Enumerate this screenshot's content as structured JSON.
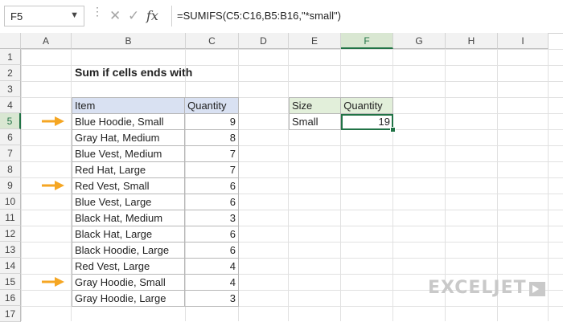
{
  "toolbar": {
    "name_box": "F5",
    "cancel_icon": "✕",
    "confirm_icon": "✓",
    "fx_label": "fx",
    "formula": "=SUMIFS(C5:C16,B5:B16,\"*small\")"
  },
  "columns": [
    "A",
    "B",
    "C",
    "D",
    "E",
    "F",
    "G",
    "H",
    "I"
  ],
  "rows": [
    "1",
    "2",
    "3",
    "4",
    "5",
    "6",
    "7",
    "8",
    "9",
    "10",
    "11",
    "12",
    "13",
    "14",
    "15",
    "16",
    "17"
  ],
  "selected_column": "F",
  "selected_row": "5",
  "sheet": {
    "title": "Sum if cells ends with",
    "table": {
      "headers": [
        "Item",
        "Quantity"
      ],
      "rows": [
        [
          "Blue Hoodie, Small",
          "9"
        ],
        [
          "Gray Hat, Medium",
          "8"
        ],
        [
          "Blue Vest, Medium",
          "7"
        ],
        [
          "Red Hat, Large",
          "7"
        ],
        [
          "Red Vest, Small",
          "6"
        ],
        [
          "Blue Vest, Large",
          "6"
        ],
        [
          "Black Hat, Medium",
          "3"
        ],
        [
          "Black Hat, Large",
          "6"
        ],
        [
          "Black Hoodie, Large",
          "6"
        ],
        [
          "Red Vest, Large",
          "4"
        ],
        [
          "Gray Hoodie, Small",
          "4"
        ],
        [
          "Gray Hoodie, Large",
          "3"
        ]
      ]
    },
    "summary": {
      "headers": [
        "Size",
        "Quantity"
      ],
      "size": "Small",
      "quantity": "19"
    },
    "arrow_rows": [
      "5",
      "9",
      "15"
    ],
    "arrow_color": "#f5a623"
  },
  "brand": {
    "logo_text": "EXCELJET",
    "color": "#c9c9c9"
  }
}
